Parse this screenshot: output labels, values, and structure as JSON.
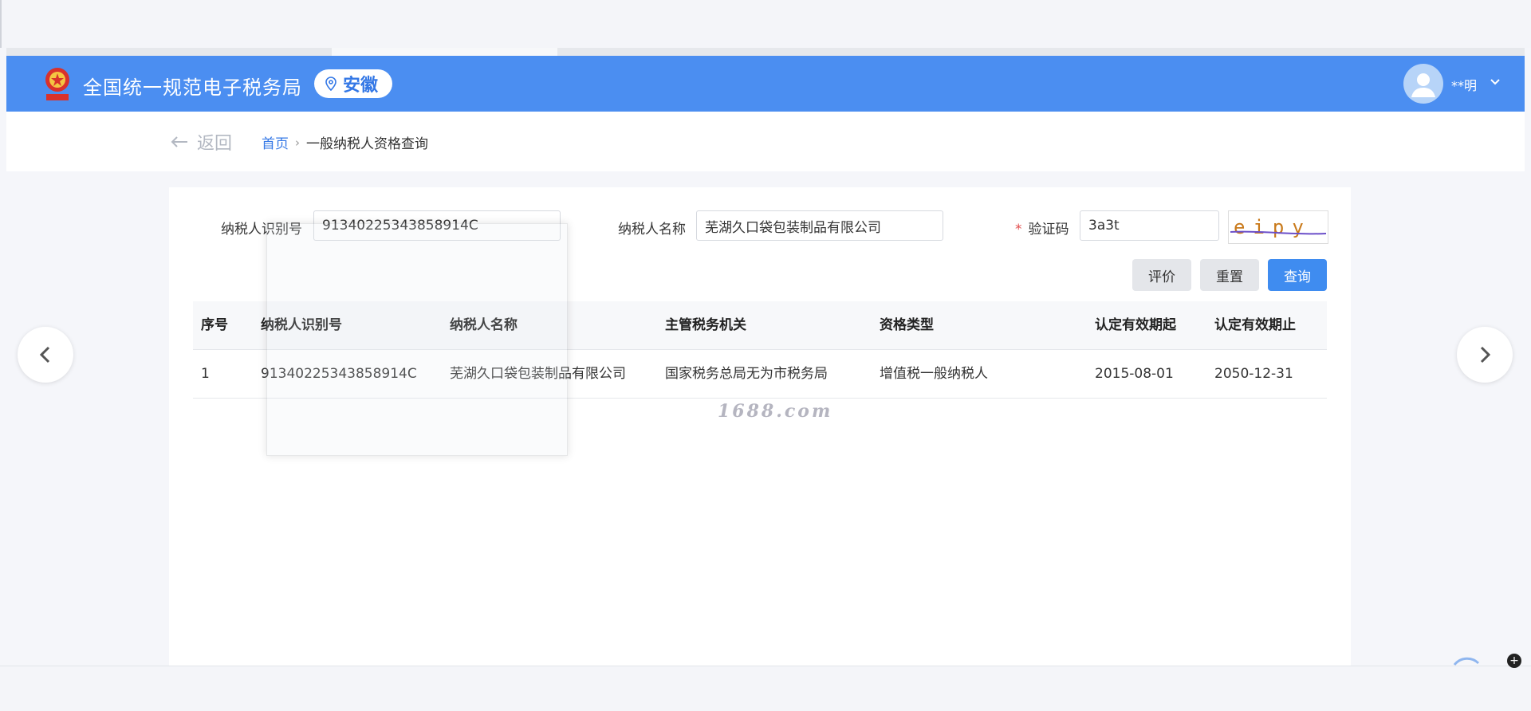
{
  "header": {
    "title": "全国统一规范电子税务局",
    "region": "安徽",
    "username": "**明"
  },
  "breadcrumb": {
    "back_label": "返回",
    "home": "首页",
    "separator": "›",
    "current": "一般纳税人资格查询"
  },
  "form": {
    "taxpayer_id_label": "纳税人识别号",
    "taxpayer_id_value": "91340225343858914C",
    "taxpayer_name_label": "纳税人名称",
    "taxpayer_name_value": "芜湖久口袋包装制品有限公司",
    "required_mark": "*",
    "captcha_label": "验证码",
    "captcha_value": "3a3t",
    "captcha_image_text": "eipy"
  },
  "buttons": {
    "evaluate": "评价",
    "reset": "重置",
    "query": "查询"
  },
  "table": {
    "headers": [
      "序号",
      "纳税人识别号",
      "纳税人名称",
      "主管税务机关",
      "资格类型",
      "认定有效期起",
      "认定有效期止"
    ],
    "rows": [
      [
        "1",
        "91340225343858914C",
        "芜湖久口袋包装制品有限公司",
        "国家税务总局无为市税务局",
        "增值税一般纳税人",
        "2015-08-01",
        "2050-12-31"
      ]
    ]
  },
  "watermark": "1688.com",
  "colors": {
    "header_bg": "#4b8ef1",
    "accent": "#3478e6",
    "query_button": "#3f8cf0",
    "required": "#e24c4c"
  },
  "icons": {
    "back": "arrow-left-icon",
    "location": "location-pin-icon",
    "avatar": "user-avatar-icon",
    "dropdown": "chevron-down-icon",
    "prev": "chevron-left-icon",
    "next": "chevron-right-icon"
  }
}
